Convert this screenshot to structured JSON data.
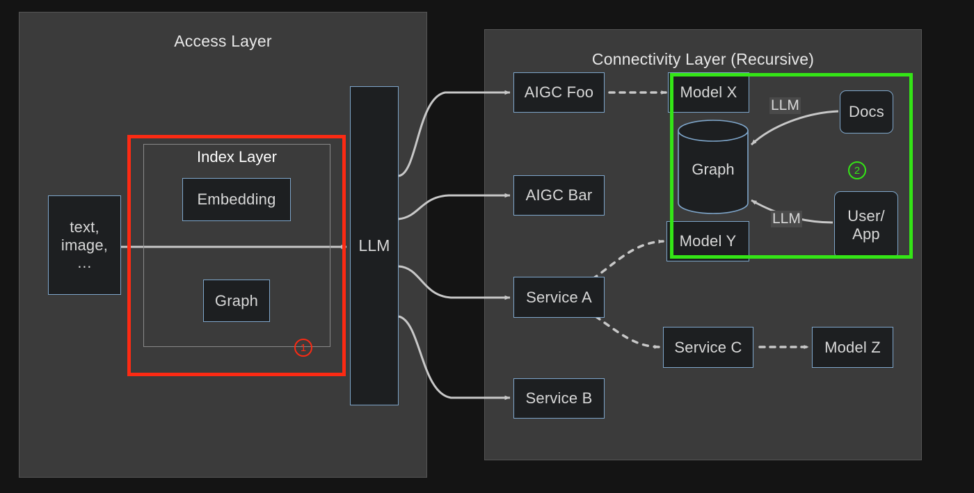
{
  "diagram": {
    "title_access": "Access Layer",
    "title_connectivity": "Connectivity Layer (Recursive)",
    "index_layer_title": "Index Layer"
  },
  "colors": {
    "background": "#141414",
    "panel": "#3b3b3b",
    "node_fill": "#1d1f21",
    "node_border": "#7fa7cc",
    "highlight_red": "#fc2a13",
    "highlight_green": "#34e516",
    "text": "#d8d8d8",
    "arrow": "#c8c8c8"
  },
  "access_layer": {
    "input_node": "text,\nimage,\n…",
    "embedding": "Embedding",
    "graph": "Graph",
    "llm": "LLM",
    "badge": "1"
  },
  "connectivity_layer": {
    "aigc_foo": "AIGC Foo",
    "aigc_bar": "AIGC Bar",
    "service_a": "Service A",
    "service_b": "Service B",
    "service_c": "Service C",
    "model_x": "Model X",
    "model_y": "Model Y",
    "model_z": "Model Z",
    "graph_db": "Graph",
    "docs": "Docs",
    "user_app": "User/\nApp",
    "llm_label_top": "LLM",
    "llm_label_bottom": "LLM",
    "badge": "2"
  }
}
